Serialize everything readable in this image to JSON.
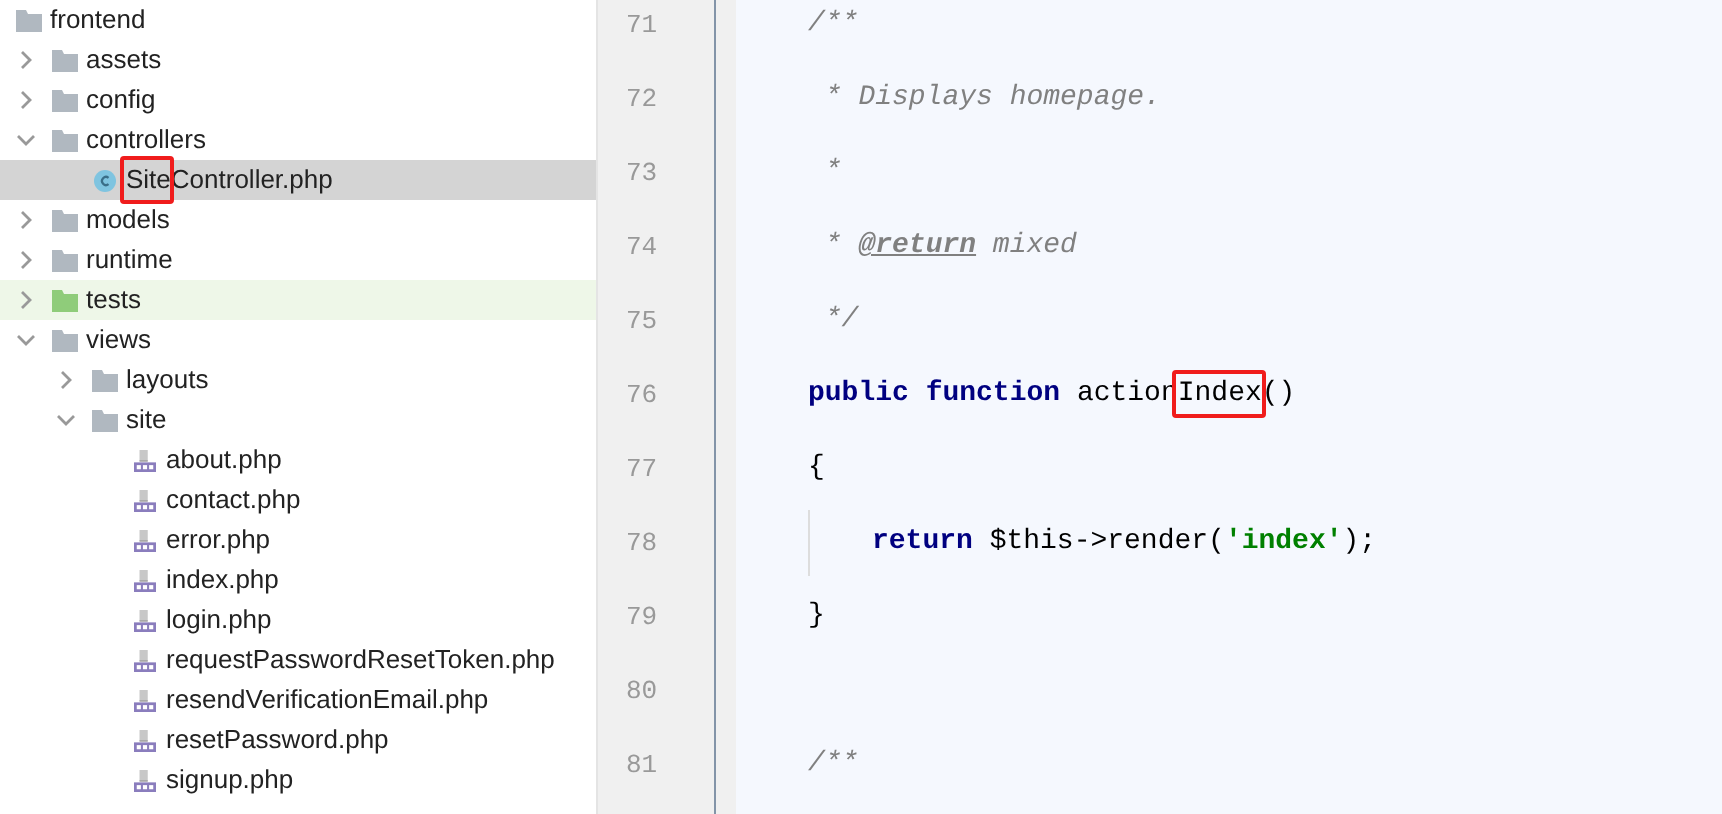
{
  "project_tree": {
    "items": [
      {
        "label": "frontend",
        "kind": "folder",
        "selected": false,
        "children": [
          {
            "label": "assets",
            "kind": "folder",
            "expanded": false,
            "selected": false
          },
          {
            "label": "config",
            "kind": "folder",
            "expanded": false,
            "selected": false
          },
          {
            "label": "controllers",
            "kind": "folder",
            "expanded": true,
            "selected": false,
            "children": [
              {
                "label_parts": [
                  {
                    "text": "Site",
                    "boxed": true
                  },
                  {
                    "text": "Controller.php",
                    "boxed": false
                  }
                ],
                "kind": "class",
                "selected": true
              }
            ]
          },
          {
            "label": "models",
            "kind": "folder",
            "expanded": false,
            "selected": false
          },
          {
            "label": "runtime",
            "kind": "folder",
            "expanded": false,
            "selected": false
          },
          {
            "label": "tests",
            "kind": "test-folder",
            "expanded": false,
            "selected": false
          },
          {
            "label": "views",
            "kind": "folder",
            "expanded": true,
            "selected": false,
            "children": [
              {
                "label": "layouts",
                "kind": "folder",
                "expanded": false,
                "selected": false
              },
              {
                "label": "site",
                "kind": "folder",
                "expanded": true,
                "selected": false,
                "children": [
                  {
                    "label": "about.php",
                    "kind": "php",
                    "selected": false
                  },
                  {
                    "label": "contact.php",
                    "kind": "php",
                    "selected": false
                  },
                  {
                    "label": "error.php",
                    "kind": "php",
                    "selected": false
                  },
                  {
                    "label": "index.php",
                    "kind": "php",
                    "selected": false
                  },
                  {
                    "label": "login.php",
                    "kind": "php",
                    "selected": false
                  },
                  {
                    "label": "requestPasswordResetToken.php",
                    "kind": "php",
                    "selected": false
                  },
                  {
                    "label": "resendVerificationEmail.php",
                    "kind": "php",
                    "selected": false
                  },
                  {
                    "label": "resetPassword.php",
                    "kind": "php",
                    "selected": false
                  },
                  {
                    "label": "signup.php",
                    "kind": "php",
                    "selected": false
                  }
                ]
              }
            ]
          }
        ]
      }
    ]
  },
  "editor": {
    "lines": [
      {
        "number": "71",
        "kind": "member",
        "tokens": [
          {
            "kind": "comment",
            "text": "/**"
          }
        ]
      },
      {
        "number": "72",
        "kind": "member",
        "tokens": [
          {
            "kind": "comment",
            "text": " * Displays homepage."
          }
        ]
      },
      {
        "number": "73",
        "kind": "member",
        "tokens": [
          {
            "kind": "comment",
            "text": " *"
          }
        ]
      },
      {
        "number": "74",
        "kind": "member",
        "tokens": [
          {
            "kind": "comment",
            "text": " * "
          },
          {
            "kind": "doc-tag",
            "text": "@return"
          },
          {
            "kind": "comment",
            "text": " mixed"
          }
        ]
      },
      {
        "number": "75",
        "kind": "member",
        "tokens": [
          {
            "kind": "comment",
            "text": " */"
          }
        ]
      },
      {
        "number": "76",
        "kind": "member",
        "tokens": [
          {
            "kind": "keyword",
            "text": "public"
          },
          {
            "kind": "keyword",
            "text": " function"
          },
          {
            "kind": "plain",
            "text": " action"
          },
          {
            "kind": "plain",
            "text": "Index",
            "boxed": true
          },
          {
            "kind": "plain",
            "text": "()"
          }
        ]
      },
      {
        "number": "77",
        "kind": "member",
        "tokens": [
          {
            "kind": "plain",
            "text": "{"
          }
        ]
      },
      {
        "number": "78",
        "kind": "body",
        "tokens": [
          {
            "kind": "keyword",
            "text": "return"
          },
          {
            "kind": "plain",
            "text": " $this->render("
          },
          {
            "kind": "string",
            "text": "'index'"
          },
          {
            "kind": "plain",
            "text": ");"
          }
        ]
      },
      {
        "number": "79",
        "kind": "member",
        "tokens": [
          {
            "kind": "plain",
            "text": "}"
          }
        ]
      },
      {
        "number": "80",
        "kind": "member"
      },
      {
        "number": "81",
        "kind": "member",
        "tokens": [
          {
            "kind": "comment",
            "text": "/**"
          }
        ]
      }
    ]
  }
}
